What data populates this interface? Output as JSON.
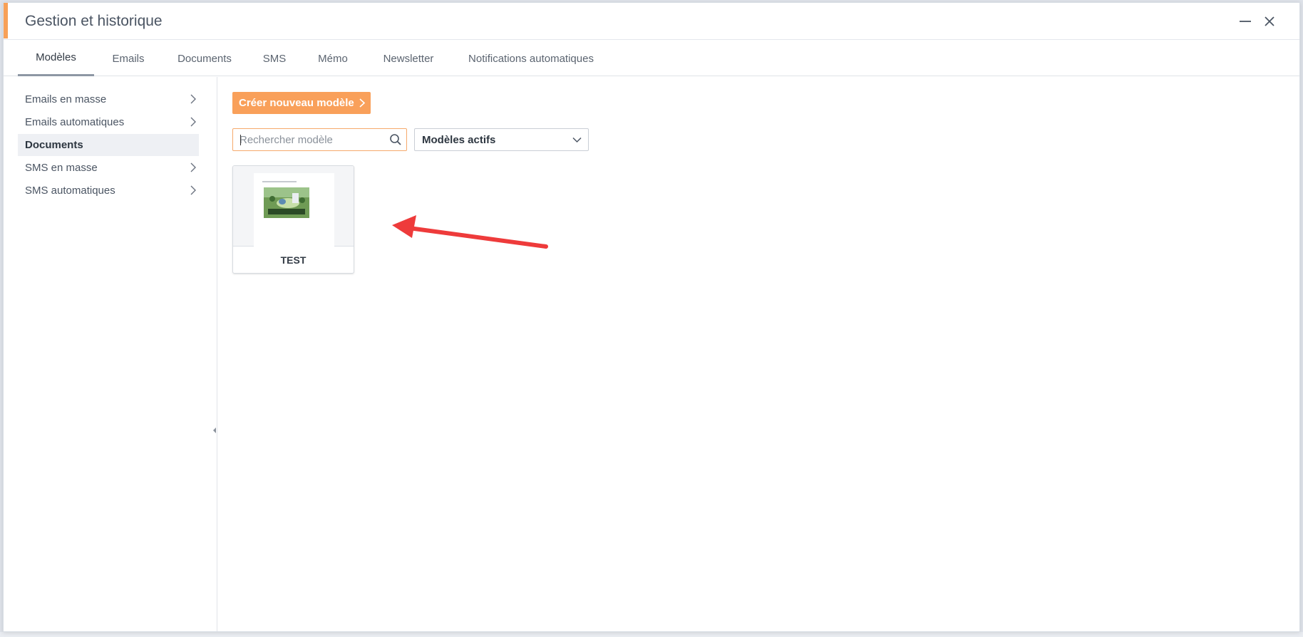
{
  "window": {
    "title": "Gestion et historique",
    "accent_color": "#f7a057"
  },
  "tabs": [
    {
      "label": "Modèles",
      "active": true
    },
    {
      "label": "Emails",
      "active": false
    },
    {
      "label": "Documents",
      "active": false
    },
    {
      "label": "SMS",
      "active": false
    },
    {
      "label": "Mémo",
      "active": false
    },
    {
      "label": "Newsletter",
      "active": false
    },
    {
      "label": "Notifications automatiques",
      "active": false
    }
  ],
  "sidebar": {
    "items": [
      {
        "label": "Emails en masse",
        "has_chevron": true,
        "active": false
      },
      {
        "label": "Emails automatiques",
        "has_chevron": true,
        "active": false
      },
      {
        "label": "Documents",
        "has_chevron": false,
        "active": true
      },
      {
        "label": "SMS en masse",
        "has_chevron": true,
        "active": false
      },
      {
        "label": "SMS automatiques",
        "has_chevron": true,
        "active": false
      }
    ]
  },
  "main": {
    "create_button_label": "Créer nouveau modèle",
    "search": {
      "placeholder": "Rechercher modèle",
      "value": ""
    },
    "filter": {
      "selected": "Modèles actifs"
    },
    "templates": [
      {
        "title": "TEST"
      }
    ]
  },
  "colors": {
    "primary_button": "#f9a05a",
    "annotation_arrow": "#ee3b3b"
  },
  "icons": {
    "minimize": "minimize-icon",
    "close": "close-icon",
    "search": "search-icon",
    "chevron_right": "chevron-right-icon",
    "chevron_down": "chevron-down-icon"
  }
}
